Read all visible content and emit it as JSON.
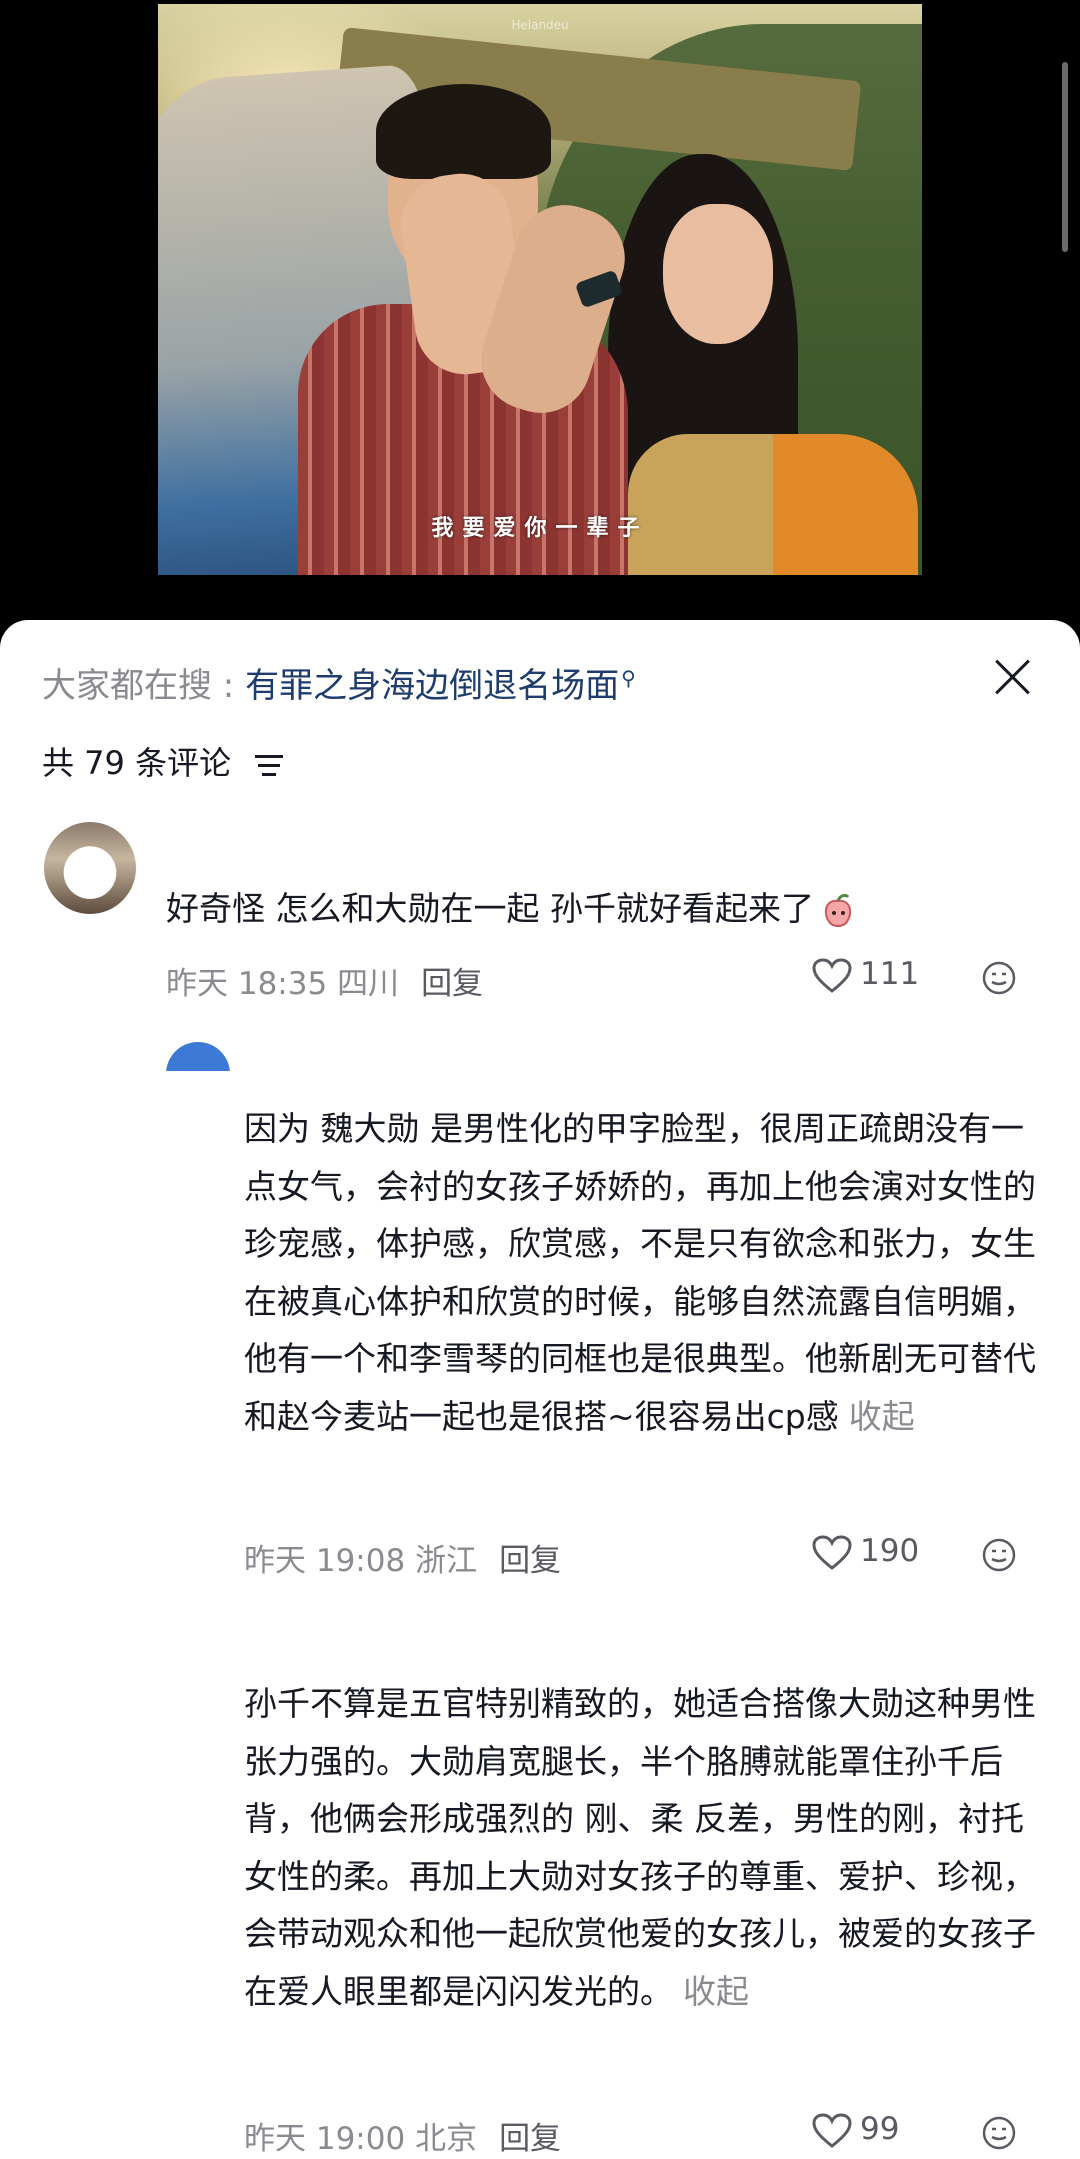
{
  "video": {
    "subtitle": "我要爱你一辈子",
    "watermark": "Helandeu"
  },
  "panel": {
    "search_prefix": "大家都在搜 : ",
    "search_term": "有罪之身海边倒退名场面",
    "count_label": "共 79 条评论"
  },
  "comments": [
    {
      "text": "好奇怪 怎么和大勋在一起 孙千就好看起来了",
      "time": "昨天 18:35",
      "location": "四川",
      "reply": "回复",
      "likes": "111"
    },
    {
      "text": "因为 魏大勋 是男性化的甲字脸型，很周正疏朗没有一点女气，会衬的女孩子娇娇的，再加上他会演对女性的珍宠感，体护感，欣赏感，不是只有欲念和张力，女生在被真心体护和欣赏的时候，能够自然流露自信明媚，他有一个和李雪琴的同框也是很典型。他新剧无可替代和赵今麦站一起也是很搭~很容易出cp感",
      "collapse": "收起",
      "time": "昨天 19:08",
      "location": "浙江",
      "reply": "回复",
      "likes": "190"
    },
    {
      "text": "孙千不算是五官特别精致的，她适合搭像大勋这种男性张力强的。大勋肩宽腿长，半个胳膊就能罩住孙千后背，他俩会形成强烈的 刚、柔 反差，男性的刚，衬托女性的柔。再加上大勋对女孩子的尊重、爱护、珍视，会带动观众和他一起欣赏他爱的女孩儿，被爱的女孩子在爱人眼里都是闪闪发光的。",
      "collapse": "收起",
      "time": "昨天 19:00",
      "location": "北京",
      "reply": "回复",
      "likes": "99"
    }
  ]
}
